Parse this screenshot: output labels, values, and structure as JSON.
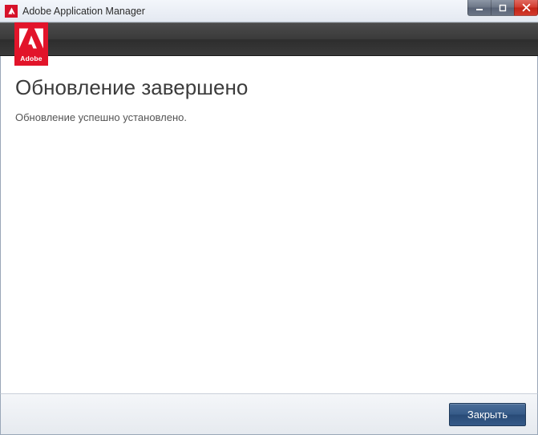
{
  "window": {
    "title": "Adobe Application Manager"
  },
  "brand": {
    "name": "Adobe"
  },
  "main": {
    "heading": "Обновление завершено",
    "description": "Обновление успешно установлено."
  },
  "footer": {
    "close_label": "Закрыть"
  }
}
